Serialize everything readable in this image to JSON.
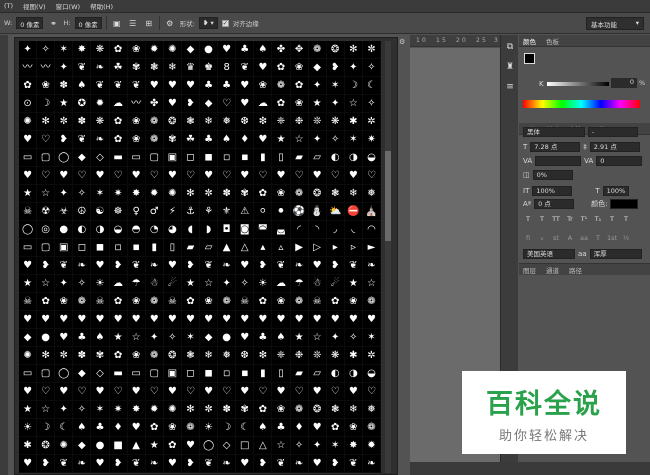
{
  "menubar": {
    "items": [
      "(T)",
      "视图(V)",
      "窗口(W)",
      "帮助(H)"
    ]
  },
  "options": {
    "w_label": "W:",
    "w_value": "0 像素",
    "link_icon": "link-icon",
    "h_label": "H:",
    "h_value": "0 像素",
    "shape_label": "形状:",
    "align_edges_label": "对齐边缘",
    "workspace": "基本功能"
  },
  "ruler": {
    "ticks": [
      "1",
      "0",
      "1",
      "5",
      "2",
      "0",
      "2",
      "5",
      "3"
    ]
  },
  "shapes_panel": {
    "glyphs": [
      "✦",
      "✧",
      "✶",
      "✸",
      "❋",
      "✿",
      "❀",
      "✹",
      "✺",
      "◆",
      "●",
      "♥",
      "♣",
      "♠",
      "✤",
      "✥",
      "❁",
      "❂",
      "✻",
      "✼",
      "〰",
      "〰",
      "✦",
      "❦",
      "❧",
      "☘",
      "✾",
      "❃",
      "❄",
      "♛",
      "♚",
      "8",
      "❦",
      "♥",
      "✿",
      "❀",
      "◆",
      "❥",
      "✦",
      "✧",
      "✿",
      "❀",
      "✽",
      "♠",
      "❦",
      "❦",
      "❦",
      "♥",
      "♥",
      "♥",
      "♣",
      "♣",
      "♥",
      "❀",
      "❁",
      "✿",
      "✦",
      "✶",
      "☽",
      "☾",
      "⊙",
      "☽",
      "★",
      "✪",
      "✹",
      "☁",
      "〰",
      "✤",
      "♥",
      "❥",
      "◆",
      "♡",
      "♥",
      "☁",
      "✿",
      "❀",
      "★",
      "✦",
      "☆",
      "✧",
      "✺",
      "✻",
      "✼",
      "✽",
      "❋",
      "✿",
      "❀",
      "❁",
      "❂",
      "❃",
      "❄",
      "❅",
      "❆",
      "❇",
      "❈",
      "❉",
      "❊",
      "❋",
      "✱",
      "✲",
      "♥",
      "♡",
      "❥",
      "❦",
      "❧",
      "✿",
      "❀",
      "❁",
      "✾",
      "☘",
      "♣",
      "♠",
      "♦",
      "♥",
      "★",
      "☆",
      "✦",
      "✧",
      "✶",
      "✷",
      "▭",
      "▢",
      "◯",
      "◆",
      "◇",
      "▬",
      "▭",
      "▢",
      "▣",
      "◻",
      "◼",
      "◽",
      "◾",
      "▮",
      "▯",
      "▰",
      "▱",
      "◐",
      "◑",
      "◒",
      "♥",
      "♡",
      "♥",
      "♡",
      "♥",
      "♡",
      "♥",
      "♡",
      "♥",
      "♡",
      "♥",
      "♡",
      "♥",
      "♡",
      "♥",
      "♡",
      "♥",
      "♡",
      "♥",
      "♡",
      "★",
      "☆",
      "✦",
      "✧",
      "✶",
      "✷",
      "✸",
      "✹",
      "✺",
      "✻",
      "✼",
      "✽",
      "✾",
      "✿",
      "❀",
      "❁",
      "❂",
      "❃",
      "❄",
      "❅",
      "☠",
      "☢",
      "☣",
      "☮",
      "☯",
      "☸",
      "♀",
      "♂",
      "⚡",
      "⚓",
      "⚘",
      "⚜",
      "⚠",
      "⚪",
      "⚫",
      "⚽",
      "⛄",
      "⛅",
      "⛔",
      "⛪",
      "◯",
      "◎",
      "●",
      "◐",
      "◑",
      "◒",
      "◓",
      "◔",
      "◕",
      "◖",
      "◗",
      "◘",
      "◙",
      "◚",
      "◛",
      "◜",
      "◝",
      "◞",
      "◟",
      "◠",
      "▭",
      "▢",
      "▣",
      "◻",
      "◼",
      "◽",
      "◾",
      "▮",
      "▯",
      "▰",
      "▱",
      "▲",
      "△",
      "▴",
      "▵",
      "▶",
      "▷",
      "▸",
      "▹",
      "►",
      "♥",
      "❥",
      "❦",
      "❧",
      "♥",
      "❥",
      "❦",
      "❧",
      "♥",
      "❥",
      "❦",
      "❧",
      "♥",
      "❥",
      "❦",
      "❧",
      "♥",
      "❥",
      "❦",
      "❧",
      "★",
      "☆",
      "✦",
      "✧",
      "☀",
      "☁",
      "☂",
      "☃",
      "☄",
      "★",
      "☆",
      "✦",
      "✧",
      "☀",
      "☁",
      "☂",
      "☃",
      "☄",
      "★",
      "☆",
      "☠",
      "✿",
      "❀",
      "❁",
      "☠",
      "✿",
      "❀",
      "❁",
      "☠",
      "✿",
      "❀",
      "❁",
      "☠",
      "✿",
      "❀",
      "❁",
      "☠",
      "✿",
      "❀",
      "❁",
      "♥",
      "♥",
      "♥",
      "♥",
      "♥",
      "♥",
      "♥",
      "♥",
      "♥",
      "♥",
      "♥",
      "♥",
      "♥",
      "♥",
      "♥",
      "♥",
      "♥",
      "♥",
      "♥",
      "♥",
      "◆",
      "●",
      "♥",
      "♣",
      "♠",
      "★",
      "☆",
      "✦",
      "✧",
      "✶",
      "◆",
      "●",
      "♥",
      "♣",
      "♠",
      "★",
      "☆",
      "✦",
      "✧",
      "✶",
      "✺",
      "✻",
      "✼",
      "✽",
      "✾",
      "✿",
      "❀",
      "❁",
      "❂",
      "❃",
      "❄",
      "❅",
      "❆",
      "❇",
      "❈",
      "❉",
      "❊",
      "❋",
      "✱",
      "✲",
      "▭",
      "▢",
      "◯",
      "◆",
      "◇",
      "▬",
      "▭",
      "▢",
      "▣",
      "◻",
      "◼",
      "◽",
      "◾",
      "▮",
      "▯",
      "▰",
      "▱",
      "◐",
      "◑",
      "◒",
      "♥",
      "♡",
      "♥",
      "♡",
      "♥",
      "♡",
      "♥",
      "♡",
      "♥",
      "♡",
      "♥",
      "♡",
      "♥",
      "♡",
      "♥",
      "♡",
      "♥",
      "♡",
      "♥",
      "♡",
      "★",
      "☆",
      "✦",
      "✧",
      "✶",
      "✷",
      "✸",
      "✹",
      "✺",
      "✻",
      "✼",
      "✽",
      "✾",
      "✿",
      "❀",
      "❁",
      "❂",
      "❃",
      "❄",
      "❅",
      "☀",
      "☽",
      "☾",
      "♠",
      "♣",
      "♦",
      "♥",
      "✿",
      "❀",
      "❁",
      "☀",
      "☽",
      "☾",
      "♠",
      "♣",
      "♦",
      "♥",
      "✿",
      "❀",
      "❁",
      "✱",
      "❂",
      "✺",
      "◆",
      "●",
      "■",
      "▲",
      "★",
      "✿",
      "♥",
      "◯",
      "◇",
      "□",
      "△",
      "☆",
      "✧",
      "✦",
      "✶",
      "✸",
      "✹",
      "♥",
      "❥",
      "❦",
      "❧",
      "♥",
      "❥",
      "❦",
      "❧",
      "♥",
      "❥",
      "❦",
      "❧",
      "♥",
      "❥",
      "❦",
      "❧",
      "♥",
      "❥",
      "❦",
      "❧"
    ]
  },
  "color_panel": {
    "tabs": [
      "颜色",
      "色板"
    ],
    "k_label": "K",
    "k_value": "0",
    "k_unit": "%"
  },
  "char_panel": {
    "tabs": [
      "调整",
      "样式",
      "字符",
      "段落"
    ],
    "font_family": "黑体",
    "font_style": "-",
    "font_size": "7.28 点",
    "leading": "2.91 点",
    "kerning": "",
    "tracking": "0",
    "tsume": "0%",
    "vscale": "100%",
    "hscale": "100%",
    "baseline": "0 点",
    "color_label": "颜色:",
    "style_buttons": [
      "T",
      "T",
      "TT",
      "Tr",
      "T¹",
      "T₁",
      "T",
      "T"
    ],
    "ot_buttons": [
      "fi",
      "ℴ",
      "st",
      "A",
      "aa",
      "T",
      "1st",
      "½"
    ],
    "language": "美国英语",
    "aa_icon": "aa",
    "antialias": "浑厚"
  },
  "bottom_tabs": [
    "图层",
    "通道",
    "路径"
  ],
  "watermark": {
    "title": "百科全说",
    "subtitle": "助你轻松解决"
  }
}
